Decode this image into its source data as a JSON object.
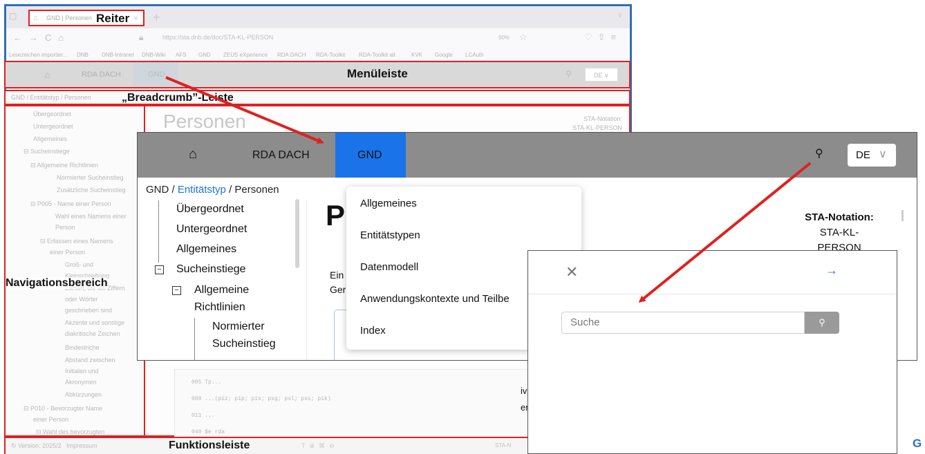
{
  "browser": {
    "tab_title": "GND | Personen",
    "tab_annotation": "Reiter",
    "url": "https://sta.dnb.de/doc/STA-KL-PERSON",
    "url_host": "dnb.de",
    "zoom": "90%",
    "bookmarks": [
      "Lesezeichen importier...",
      "DNB",
      "DNB-Intranet",
      "DNB-Wiki",
      "AFS",
      "GND",
      "ZEUS eXperience",
      "RDA DACH",
      "RDA-Toolkit",
      "RDA-Toolkit alt",
      "KVK",
      "Google",
      "LCAuth"
    ]
  },
  "menu": {
    "rda": "RDA DACH",
    "gnd": "GND",
    "lang": "DE",
    "annotation": "Menüleiste"
  },
  "breadcrumb": {
    "items": [
      "GND",
      "Entitätstyp",
      "Personen"
    ],
    "text": "GND / Entitätstyp / Personen",
    "annotation": "„Breadcrumb”-Leiste"
  },
  "nav": {
    "annotation": "Navigationsbereich",
    "items": [
      "Übergeordnet",
      "Untergeordnet",
      "Allgemeines",
      "Sucheinstiege",
      "Allgemeine Richtlinien",
      "Normierter Sucheinstieg",
      "Zusätzliche Sucheinstieg",
      "P005 - Name einer Person",
      "Wahl eines Namens einer",
      "Person",
      "Erfassen eines Namens",
      "einer Person",
      "Groß- und",
      "Kleinschreibung",
      "Zahlen, die als Ziffern",
      "oder Wörter",
      "geschrieben sind",
      "Akzente und sonstige",
      "diakritische Zeichen",
      "Bindestriche",
      "Abstand zwischen",
      "Initialen und",
      "Akronymen",
      "Abkürzungen",
      "P010 - Bevorzugter Name",
      "einer Person",
      "Wahl des bevorzugten"
    ]
  },
  "content": {
    "title": "Personen",
    "sta_label": "STA-Notation:",
    "sta_value": "STA-KL-PERSON",
    "code_lines": [
      "005  Tp...",
      "008  ...(piz; pip; pis; pxg; pxl; pxs; pik)",
      "011  ...",
      "040  $e rda"
    ]
  },
  "footer": {
    "version": "Version: 2025/2",
    "impressum": "Impressum",
    "annotation": "Funktionsleiste",
    "sta": "STA-N"
  },
  "zoomed": {
    "menu_rda": "RDA DACH",
    "menu_gnd": "GND",
    "lang": "DE",
    "crumb_gnd": "GND",
    "crumb_entity": "Entitätstyp",
    "crumb_personen": "Personen",
    "nav": [
      "Übergeordnet",
      "Untergeordnet",
      "Allgemeines",
      "Sucheinstiege",
      "Allgemeine",
      "Richtlinien",
      "Normierter",
      "Sucheinstieg"
    ],
    "title_initial": "P",
    "ein_lines": [
      "Ein",
      "Ger"
    ],
    "sta_label": "STA-Notation:",
    "sta_line1": "STA-KL-",
    "sta_line2": "PERSON",
    "dropdown": [
      "Allgemeines",
      "Entitätstypen",
      "Datenmodell",
      "Anwendungskontexte und Teilbe",
      "Index"
    ]
  },
  "search": {
    "placeholder": "Suche",
    "peek1": "ivic",
    "peek2": "en a"
  },
  "edge_char": "G",
  "colors": {
    "annotation_red": "#e02020",
    "accent_blue": "#1a73e8",
    "menu_gray": "#8c8c8c"
  }
}
